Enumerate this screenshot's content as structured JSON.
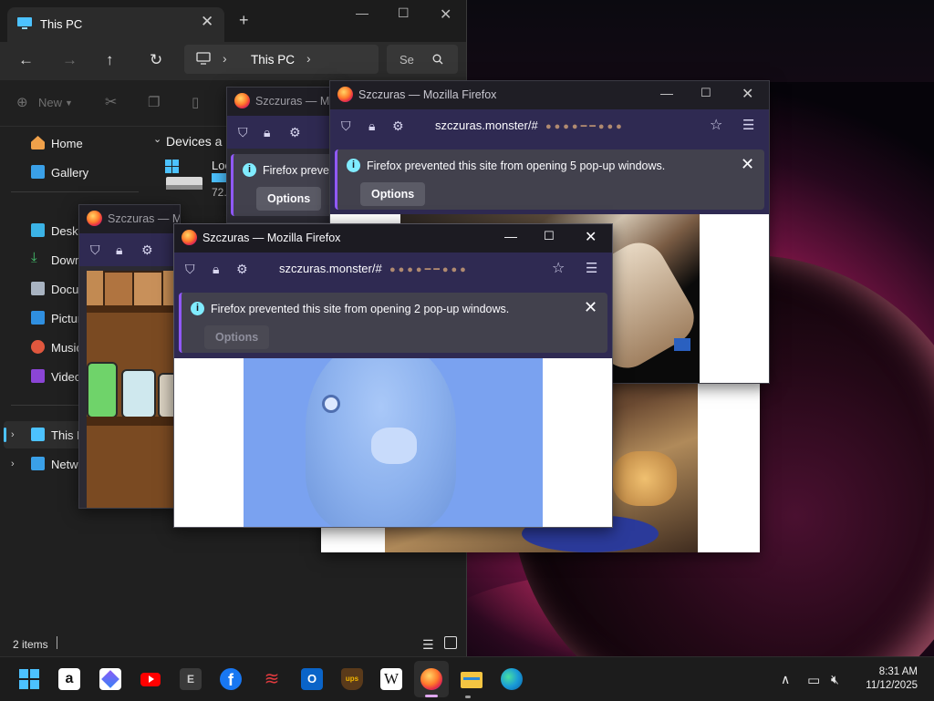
{
  "explorer": {
    "tab_title": "This PC",
    "breadcrumb": "This PC",
    "search_placeholder": "Se",
    "toolbar_new": "New",
    "content_group": "Devices a",
    "drive_label": "Loc",
    "drive_size": "72.",
    "status_items": "2 items",
    "nav": {
      "home": "Home",
      "gallery": "Gallery",
      "desktop": "Deskt",
      "downloads": "Down",
      "documents": "Docu",
      "pictures": "Pictur",
      "music": "Music",
      "videos": "Video",
      "this_pc": "This P",
      "network": "Netwo"
    }
  },
  "firefox": {
    "back2": {
      "title": "Szczuras — Mo",
      "notice": "Firefox prevent",
      "options": "Options"
    },
    "back1": {
      "title": "Szczuras — Mozilla Firefox",
      "url": "szczuras.monster/#",
      "notice": "Firefox prevented this site from opening 5 pop-up windows.",
      "options": "Options"
    },
    "back3": {
      "title": "Szczuras — Mozilla Firefo"
    },
    "front": {
      "title": "Szczuras — Mozilla Firefox",
      "url": "szczuras.monster/#",
      "notice": "Firefox prevented this site from opening 2 pop-up windows.",
      "options": "Options"
    }
  },
  "taskbar": {
    "time": "8:31 AM",
    "date": "11/12/2025",
    "apps": [
      "start-icon",
      "amazon-icon",
      "copilot-icon",
      "youtube-icon",
      "epic-games-icon",
      "facebook-icon",
      "expedia-icon",
      "outlook-icon",
      "ups-icon",
      "wikipedia-icon",
      "firefox-icon",
      "file-explorer-icon",
      "edge-icon"
    ]
  },
  "colors": {
    "firefox_toolbar": "#2f2a52",
    "firefox_notification": "#42414d",
    "accent": "#4cc2ff",
    "taskbar": "#1c1c1c"
  }
}
